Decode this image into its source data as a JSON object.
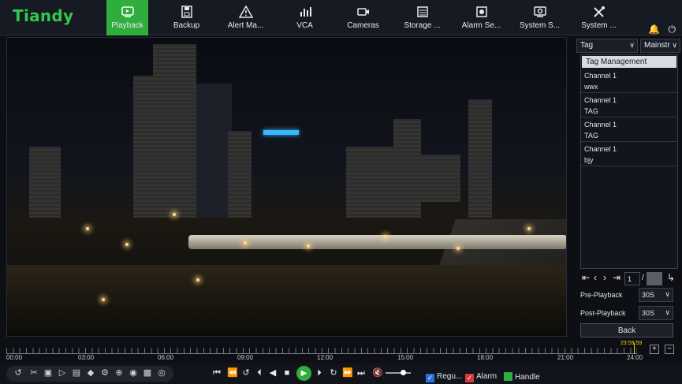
{
  "brand": {
    "logo_text": "Tiandy",
    "accent": "#2fae3d"
  },
  "nav": [
    {
      "label": "Playback",
      "icon": "playback-icon",
      "active": true
    },
    {
      "label": "Backup",
      "icon": "backup-icon"
    },
    {
      "label": "Alert Ma...",
      "icon": "alert-icon"
    },
    {
      "label": "VCA",
      "icon": "vca-icon"
    },
    {
      "label": "Cameras",
      "icon": "camera-icon"
    },
    {
      "label": "Storage ...",
      "icon": "storage-icon"
    },
    {
      "label": "Alarm Se...",
      "icon": "alarm-icon"
    },
    {
      "label": "System S...",
      "icon": "system-settings-icon"
    },
    {
      "label": "System ...",
      "icon": "tools-icon"
    }
  ],
  "side": {
    "mode_select": "Tag",
    "stream_select": "Mainstr",
    "tag_header": "Tag Management",
    "tags": [
      {
        "channel": "Channel 1",
        "name": "wwx"
      },
      {
        "channel": "Channel 1",
        "name": "TAG"
      },
      {
        "channel": "Channel 1",
        "name": "TAG"
      },
      {
        "channel": "Channel 1",
        "name": "bjy"
      }
    ],
    "page_current": "1",
    "page_separator": "/",
    "pre_playback_label": "Pre-Playback",
    "pre_playback_value": "30S",
    "post_playback_label": "Post-Playback",
    "post_playback_value": "30S",
    "back_label": "Back"
  },
  "timeline": {
    "ticks": [
      "00:00",
      "03:00",
      "06:00",
      "09:00",
      "12:00",
      "15:00",
      "18:00",
      "21:00",
      "24:00"
    ],
    "current_time": "23:59:59",
    "zoom_in": "+",
    "zoom_out": "−"
  },
  "legend": {
    "regular": "Regu...",
    "alarm": "Alarm",
    "handle": "Handle",
    "regular_color": "#2b6fe0",
    "alarm_color": "#d63a3a",
    "handle_color": "#2fae3d"
  }
}
